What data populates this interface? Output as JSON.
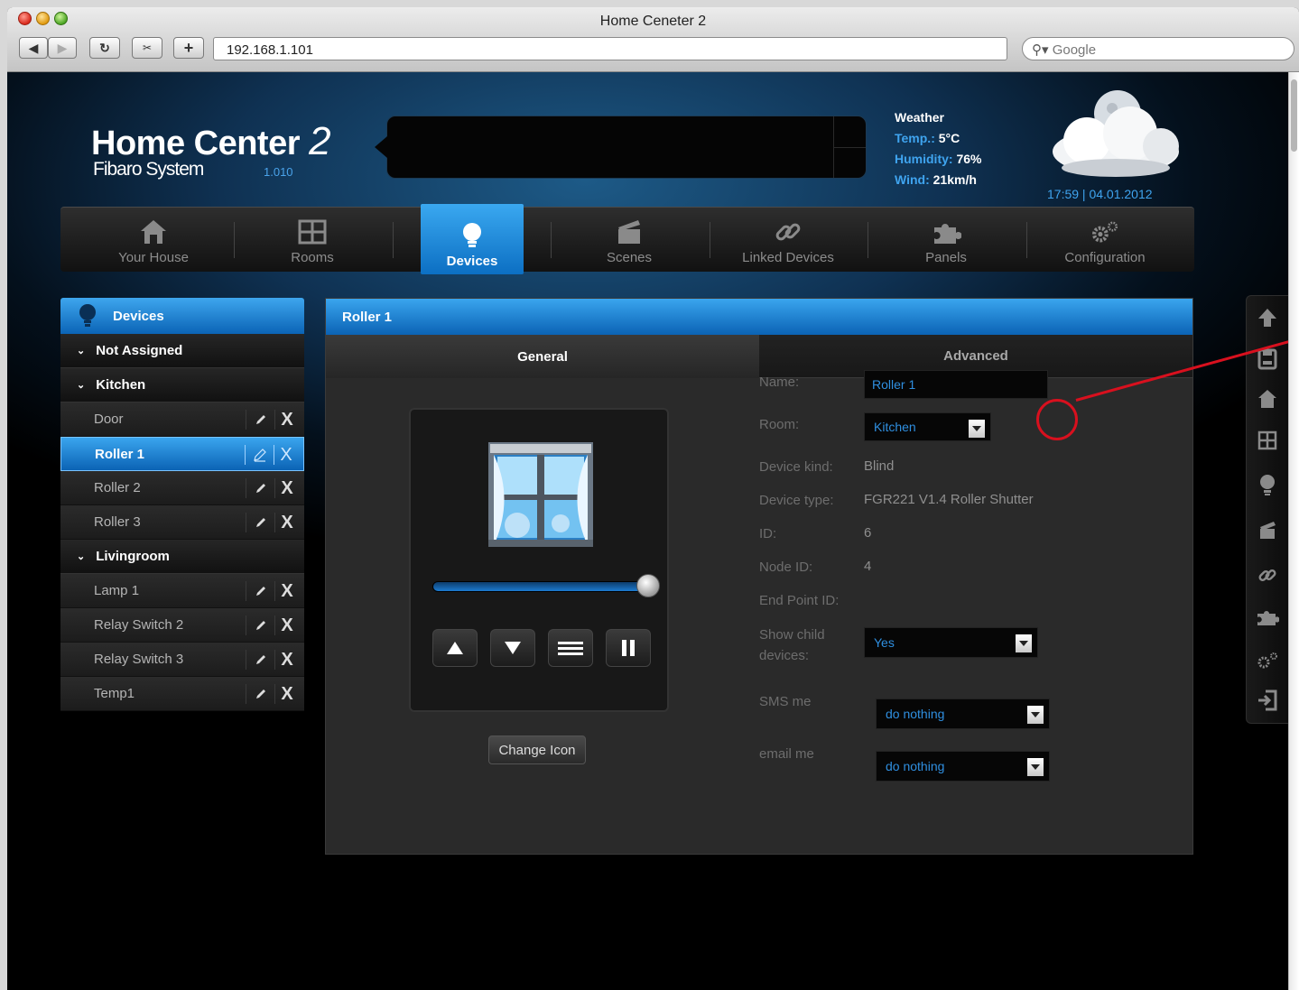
{
  "browser": {
    "title": "Home Ceneter 2",
    "url": "192.168.1.101",
    "search_placeholder": "Google"
  },
  "header": {
    "logo_title": "Home Center",
    "logo_number": "2",
    "logo_sub": "Fibaro System",
    "version": "1.010",
    "weather": {
      "title": "Weather",
      "temp_label": "Temp.:",
      "temp_value": "5°C",
      "humidity_label": "Humidity:",
      "humidity_value": "76%",
      "wind_label": "Wind:",
      "wind_value": "21km/h",
      "datetime": "17:59 | 04.01.2012"
    }
  },
  "nav": {
    "items": [
      {
        "label": "Your House",
        "icon": "house-icon"
      },
      {
        "label": "Rooms",
        "icon": "rooms-icon"
      },
      {
        "label": "Devices",
        "icon": "bulb-icon"
      },
      {
        "label": "Scenes",
        "icon": "clapper-icon"
      },
      {
        "label": "Linked Devices",
        "icon": "link-icon"
      },
      {
        "label": "Panels",
        "icon": "puzzle-icon"
      },
      {
        "label": "Configuration",
        "icon": "gears-icon"
      }
    ],
    "active": "Devices"
  },
  "left_panel": {
    "title": "Devices",
    "groups": [
      {
        "name": "Not Assigned",
        "items": []
      },
      {
        "name": "Kitchen",
        "items": [
          "Door",
          "Roller 1",
          "Roller 2",
          "Roller 3"
        ]
      },
      {
        "name": "Livingroom",
        "items": [
          "Lamp 1",
          "Relay Switch 2",
          "Relay Switch 3",
          "Temp1"
        ]
      }
    ],
    "selected": "Roller 1",
    "delete_glyph": "X"
  },
  "main": {
    "title": "Roller 1",
    "tabs": [
      "General",
      "Advanced"
    ],
    "active_tab": "General",
    "level": 1.0,
    "change_icon_label": "Change Icon",
    "form": {
      "name_label": "Name:",
      "name_value": "Roller 1",
      "room_label": "Room:",
      "room_value": "Kitchen",
      "kind_label": "Device kind:",
      "kind_value": "Blind",
      "type_label": "Device type:",
      "type_value": "FGR221 V1.4 Roller Shutter",
      "id_label": "ID:",
      "id_value": "6",
      "node_label": "Node ID:",
      "node_value": "4",
      "endpoint_label": "End Point ID:",
      "show_child_label_1": "Show child",
      "show_child_label_2": "devices:",
      "show_child_value": "Yes",
      "sms_label": "SMS me",
      "sms_value": "do nothing",
      "email_label": "email me",
      "email_value": "do nothing"
    }
  },
  "colors": {
    "accent": "#2f8fe0",
    "annotation": "#d8101e"
  }
}
